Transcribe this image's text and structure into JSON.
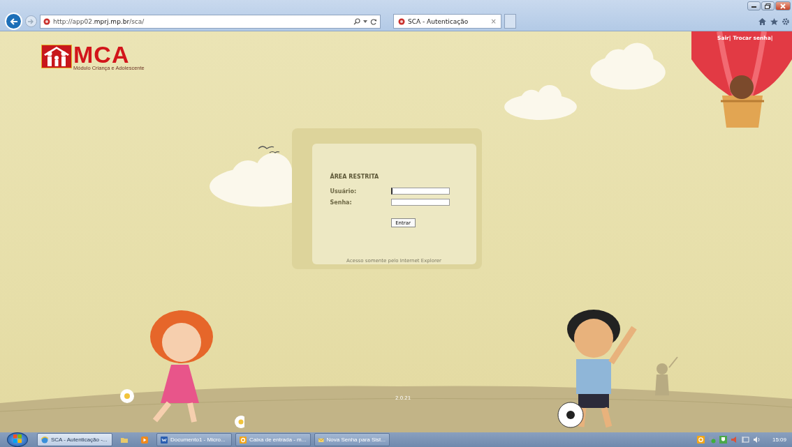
{
  "browser": {
    "address_host_prefix": "http://app02.",
    "address_domain": "mprj.mp.br",
    "address_path": "/sca/",
    "tab": {
      "title": "SCA - Autenticação",
      "close": "×",
      "selected": true
    }
  },
  "header": {
    "links": [
      {
        "label": "Sair|"
      },
      {
        "label": "Trocar senha|"
      }
    ]
  },
  "logo": {
    "title": "MCA",
    "subtitle": "Módulo Criança e Adolescente"
  },
  "login": {
    "heading": "ÁREA RESTRITA",
    "fields": [
      {
        "label": "Usuário:",
        "focused": true
      },
      {
        "label": "Senha:",
        "focused": false
      }
    ],
    "button": "Entrar",
    "note": "Acesso somente pelo Internet Explorer"
  },
  "version": "2.0.21",
  "taskbar": {
    "items": [
      {
        "kind": "ie",
        "label": "SCA - Autenticação -...",
        "selected": true
      },
      {
        "kind": "folder",
        "selected": false
      },
      {
        "kind": "media",
        "selected": false
      },
      {
        "kind": "word",
        "label": "Documento1 - Micro...",
        "selected": false
      },
      {
        "kind": "outlook",
        "label": "Caixa de entrada - m...",
        "selected": false
      },
      {
        "kind": "mail",
        "label": "Nova Senha para Sist...",
        "selected": false
      }
    ],
    "clock": "15:09"
  }
}
